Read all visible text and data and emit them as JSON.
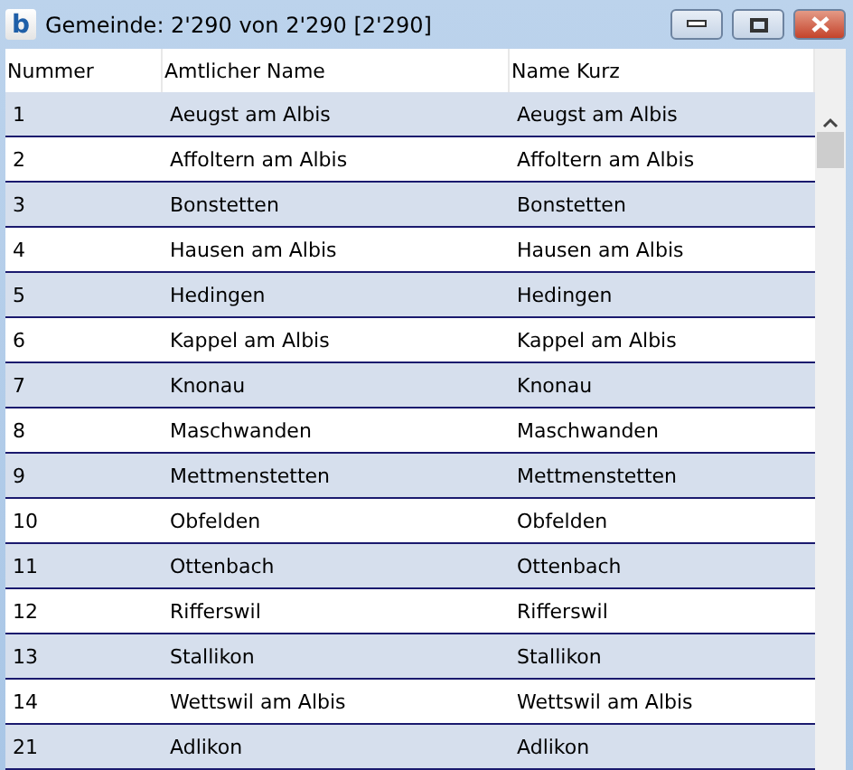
{
  "window": {
    "app_letter": "b",
    "title": "Gemeinde: 2'290 von 2'290 [2'290]"
  },
  "table": {
    "columns": [
      "Nummer",
      "Amtlicher Name",
      "Name Kurz"
    ],
    "rows": [
      [
        "1",
        "Aeugst am Albis",
        "Aeugst am Albis"
      ],
      [
        "2",
        "Affoltern am Albis",
        "Affoltern am Albis"
      ],
      [
        "3",
        "Bonstetten",
        "Bonstetten"
      ],
      [
        "4",
        "Hausen am Albis",
        "Hausen am Albis"
      ],
      [
        "5",
        "Hedingen",
        "Hedingen"
      ],
      [
        "6",
        "Kappel am Albis",
        "Kappel am Albis"
      ],
      [
        "7",
        "Knonau",
        "Knonau"
      ],
      [
        "8",
        "Maschwanden",
        "Maschwanden"
      ],
      [
        "9",
        "Mettmenstetten",
        "Mettmenstetten"
      ],
      [
        "10",
        "Obfelden",
        "Obfelden"
      ],
      [
        "11",
        "Ottenbach",
        "Ottenbach"
      ],
      [
        "12",
        "Rifferswil",
        "Rifferswil"
      ],
      [
        "13",
        "Stallikon",
        "Stallikon"
      ],
      [
        "14",
        "Wettswil am Albis",
        "Wettswil am Albis"
      ],
      [
        "21",
        "Adlikon",
        "Adlikon"
      ]
    ]
  }
}
